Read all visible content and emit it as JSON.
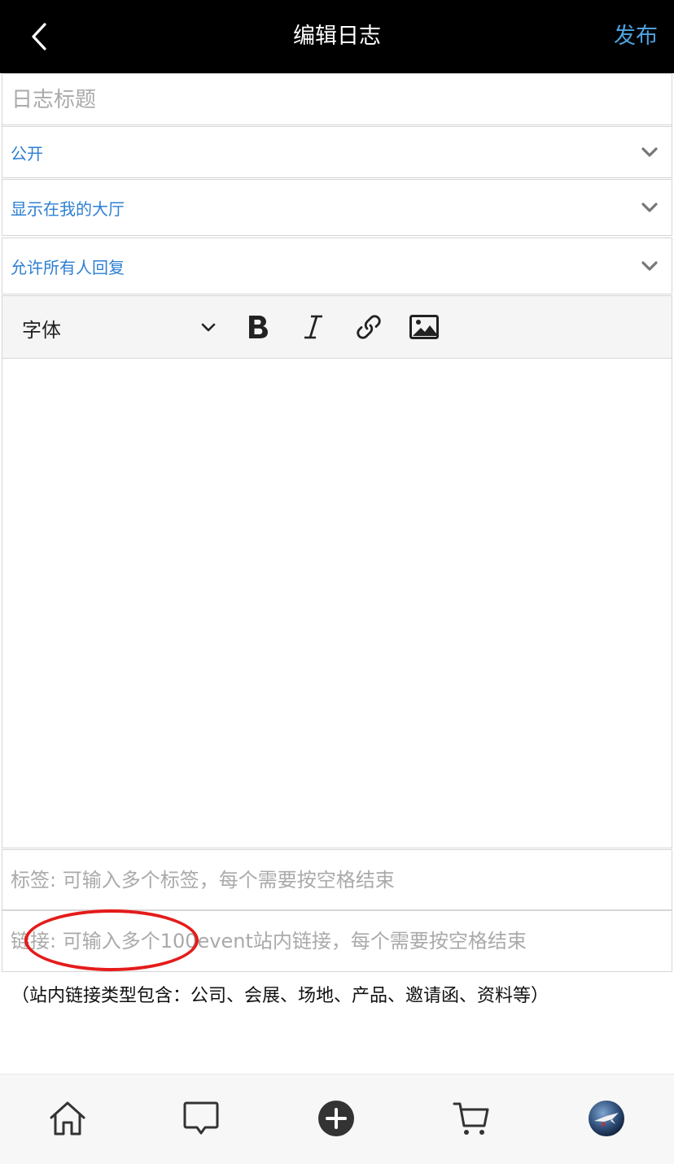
{
  "header": {
    "back_icon": "chevron-left-icon",
    "title": "编辑日志",
    "publish_label": "发布",
    "publish_color": "#4da3e0"
  },
  "form": {
    "title_placeholder": "日志标题",
    "visibility": "公开",
    "display": "显示在我的大厅",
    "reply_permission": "允许所有人回复",
    "accent_color": "#2d7fd3"
  },
  "toolbar": {
    "font_label": "字体",
    "icons": [
      "bold-icon",
      "italic-icon",
      "link-icon",
      "image-icon"
    ]
  },
  "tags": {
    "placeholder": "标签: 可输入多个标签，每个需要按空格结束"
  },
  "links": {
    "placeholder": "链接: 可输入多个100event站内链接，每个需要按空格结束"
  },
  "note": "（站内链接类型包含：公司、会展、场地、产品、邀请函、资料等）",
  "tabbar": {
    "icons": [
      "home-icon",
      "message-icon",
      "add-icon",
      "cart-icon",
      "avatar"
    ]
  }
}
